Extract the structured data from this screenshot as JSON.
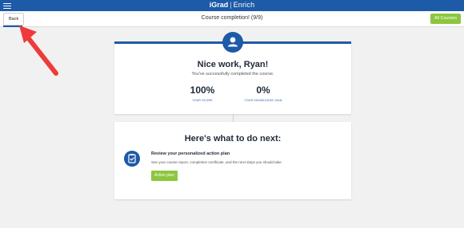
{
  "header": {
    "logo_left": "iGrad",
    "logo_sep": "|",
    "logo_right": "Enrich",
    "subtitle": "Course completion! (9/9)",
    "back_label": "Back",
    "all_courses_label": "All Courses"
  },
  "completion": {
    "heading": "Nice work, Ryan!",
    "message": "You've successfully completed the course.",
    "stats": [
      {
        "value": "100%",
        "label": "YOUR SCORE"
      },
      {
        "value": "0%",
        "label": "YOUR KNOWLEDGE GAIN"
      }
    ]
  },
  "next_steps": {
    "heading": "Here's what to do next:",
    "item": {
      "title": "Review your personalized action plan",
      "description": "See your course report, completion certificate, and the next steps you should take.",
      "button_label": "Action plan"
    }
  },
  "colors": {
    "brand_blue": "#1d5aa7",
    "accent_green": "#8cc63f",
    "annotation_red": "#ef3a3a"
  }
}
